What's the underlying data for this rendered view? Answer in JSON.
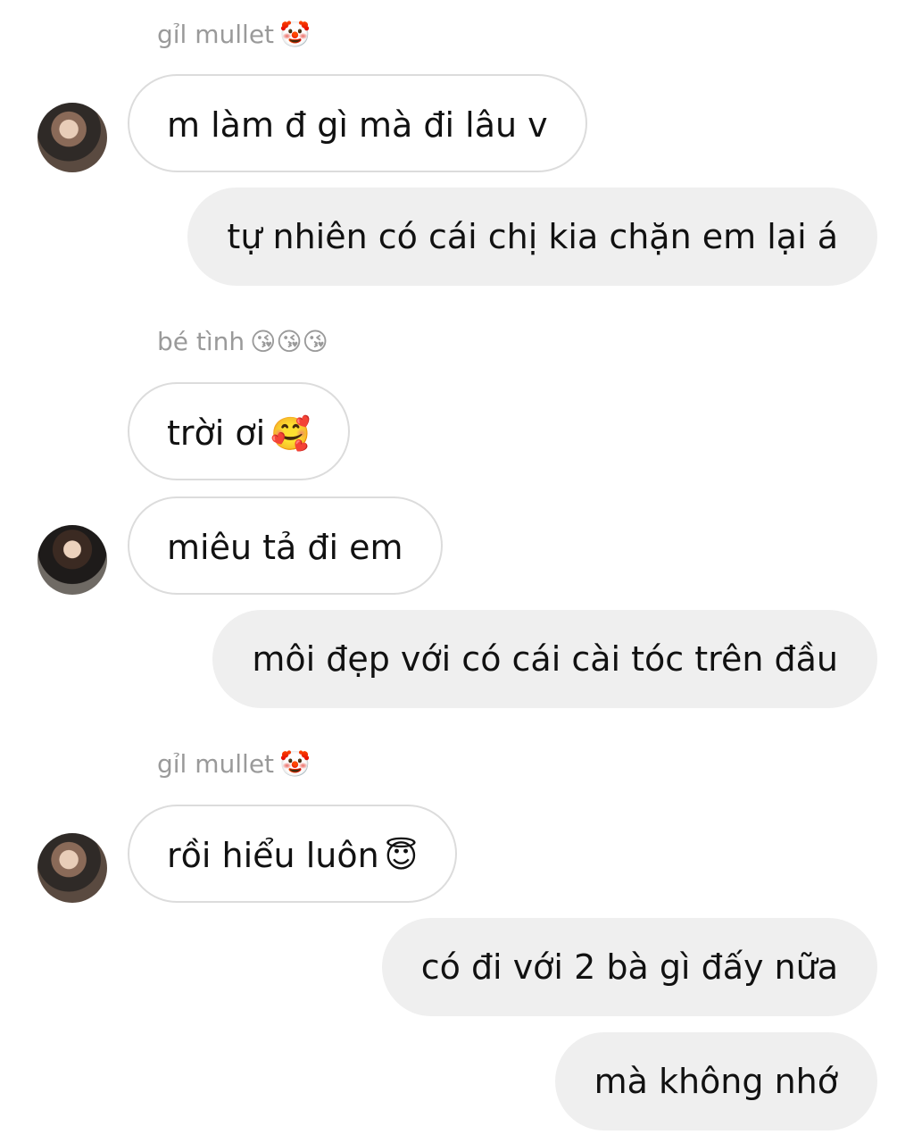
{
  "messages": [
    {
      "type": "sender",
      "name": "gỉl mullet",
      "emoji": "🤡"
    },
    {
      "type": "in",
      "text": "m làm đ gì mà đi lâu v",
      "avatar": "profile-photo-1"
    },
    {
      "type": "out",
      "text": "tự nhiên có cái chị kia chặn em lại á"
    },
    {
      "type": "sender",
      "name": "bé tình",
      "emoji": "😘😘😘"
    },
    {
      "type": "in",
      "text": "trời ơi",
      "emoji": "🥰"
    },
    {
      "type": "in",
      "text": "miêu tả đi em",
      "avatar": "profile-photo-2"
    },
    {
      "type": "out",
      "text": "môi đẹp với có cái cài tóc trên đầu"
    },
    {
      "type": "sender",
      "name": "gỉl mullet",
      "emoji": "🤡"
    },
    {
      "type": "in",
      "text": "rồi hiểu luôn",
      "emoji": "😇",
      "avatar": "profile-photo-1"
    },
    {
      "type": "out",
      "text": "có đi với 2 bà gì đấy nữa"
    },
    {
      "type": "out",
      "text": "mà không nhớ"
    }
  ]
}
